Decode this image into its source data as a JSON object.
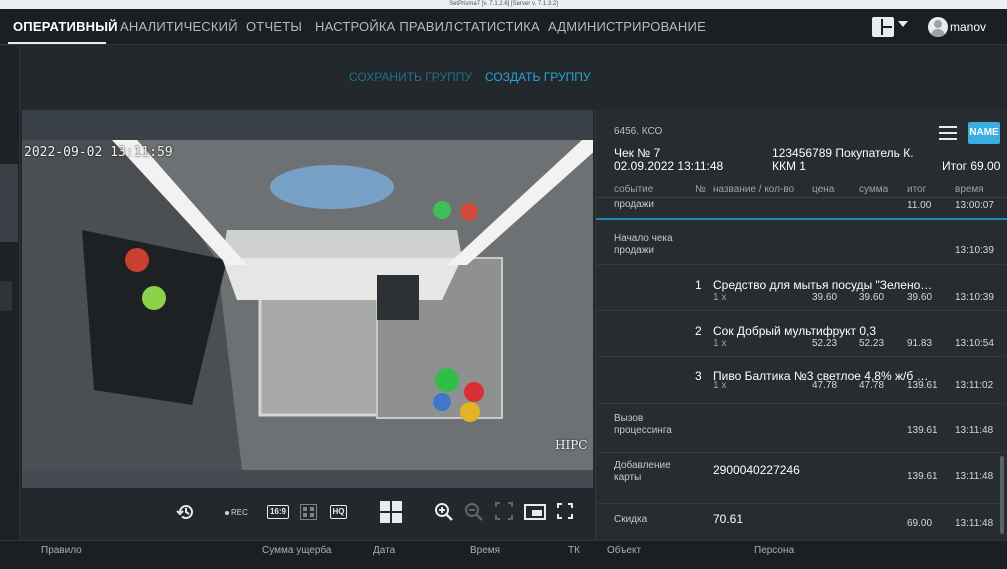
{
  "window": {
    "title": "SetPrisma7   [v. 7.1.2.6]   [Server v. 7.1.3.2]"
  },
  "nav": {
    "tabs": [
      {
        "label": "ОПЕРАТИВНЫЙ",
        "active": true
      },
      {
        "label": "АНАЛИТИЧЕСКИЙ",
        "active": false
      },
      {
        "label": "ОТЧЕТЫ",
        "active": false
      },
      {
        "label": "НАСТРОЙКА ПРАВИЛ",
        "active": false
      },
      {
        "label": "СТАТИСТИКА",
        "active": false
      },
      {
        "label": "АДМИНИСТРИРОВАНИЕ",
        "active": false
      }
    ],
    "layout_icon": "grid-layout-icon",
    "user_name": "manov"
  },
  "group_actions": {
    "save": "СОХРАНИТЬ ГРУППУ",
    "create": "СОЗДАТЬ ГРУППУ"
  },
  "video": {
    "timestamp": "2022-09-02 13:11:59",
    "brand": "HIPC"
  },
  "controls": {
    "rec": "REC",
    "aspect": "16:9",
    "hq": "HQ",
    "icons": [
      "history-icon",
      "rec-indicator",
      "aspect-ratio-icon",
      "mosaic-icon",
      "hq-icon",
      "grid-layout-icon",
      "zoom-in-icon",
      "zoom-out-icon",
      "fit-icon",
      "window-icon",
      "fullscreen-icon"
    ]
  },
  "receipt": {
    "store": "6456. КСО",
    "check": "Чек № 7",
    "datetime": "02.09.2022 13:11:48",
    "customer": "123456789 Покупатель К.",
    "kkm": "ККМ 1",
    "total": "Итог 69.00",
    "badge": "NAME",
    "columns": {
      "event": "событие",
      "num": "№",
      "name": "название / кол-во",
      "price": "цена",
      "sum": "сумма",
      "total": "итог",
      "time": "время"
    },
    "rows": [
      {
        "event": "продажи",
        "num": "",
        "title": "",
        "qty": "",
        "price": "",
        "sum": "",
        "total": "11.00",
        "time": "13:00:07"
      },
      {
        "event": "Начало чека\nпродажи",
        "num": "",
        "title": "",
        "qty": "",
        "price": "",
        "sum": "",
        "total": "",
        "time": "13:10:39"
      },
      {
        "event": "",
        "num": "1",
        "title": "Средство для мытья посуды \"Зелено…",
        "qty": "1 x",
        "price": "39.60",
        "sum": "39.60",
        "total": "39.60",
        "time": "13:10:39"
      },
      {
        "event": "",
        "num": "2",
        "title": "Сок Добрый мультифрукт 0,3",
        "qty": "1 x",
        "price": "52.23",
        "sum": "52.23",
        "total": "91.83",
        "time": "13:10:54"
      },
      {
        "event": "",
        "num": "3",
        "title": "Пиво Балтика №3 светлое 4,8% ж/б …",
        "qty": "1 x",
        "price": "47.78",
        "sum": "47.78",
        "total": "139.61",
        "time": "13:11:02"
      },
      {
        "event": "Вызов\nпроцессинга",
        "num": "",
        "title": "",
        "qty": "",
        "price": "",
        "sum": "",
        "total": "139.61",
        "time": "13:11:48"
      },
      {
        "event": "Добавление\nкарты",
        "num": "",
        "title": "2900040227246",
        "qty": "",
        "price": "",
        "sum": "",
        "total": "139.61",
        "time": "13:11:48"
      },
      {
        "event": "Скидка",
        "num": "",
        "title": "70.61",
        "qty": "",
        "price": "",
        "sum": "",
        "total": "69.00",
        "time": "13:11:48"
      }
    ]
  },
  "bottom_table": {
    "columns": [
      "Правило",
      "Сумма ущерба",
      "Дата",
      "Время",
      "ТК",
      "Объект",
      "Персона"
    ]
  }
}
